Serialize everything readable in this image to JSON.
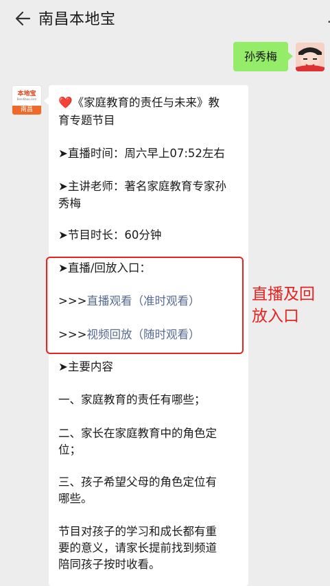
{
  "nav": {
    "title": "南昌本地宝",
    "back_icon": "back-arrow-icon",
    "more_label": "·"
  },
  "sent": {
    "text": "孙秀梅"
  },
  "bot": {
    "logo_top": "本地宝",
    "logo_sub": "Bendibao.com",
    "logo_city": "南昌"
  },
  "message": {
    "line1": "《家庭教育的责任与未来》教",
    "line2": "育专题节目",
    "time": "➤直播时间：周六早上07:52左右",
    "teacher1": "➤主讲老师：著名家庭教育专家孙",
    "teacher2": "秀梅",
    "duration": "➤节目时长：60分钟",
    "entry_title": "➤直播/回放入口：",
    "link_prefix": ">>>",
    "live_link": "直播观看（准时观看）",
    "replay_link": "视频回放（随时观看）",
    "content_title": "➤主要内容",
    "item1": "一、家庭教育的责任有哪些；",
    "item2a": "二、家长在家庭教育中的角色定",
    "item2b": "位；",
    "item3a": "三、孩子希望父母的角色定位有",
    "item3b": "哪些。",
    "outro1": "节目对孩子的学习和成长都有重",
    "outro2": "要的意义，请家长提前找到频道",
    "outro3": "陪同孩子按时收看。"
  },
  "annotation": {
    "line1": "直播及回",
    "line2": "放入口"
  },
  "colors": {
    "accent_red": "#e8221f",
    "link": "#576b95",
    "sent_bubble": "#95ec69"
  }
}
